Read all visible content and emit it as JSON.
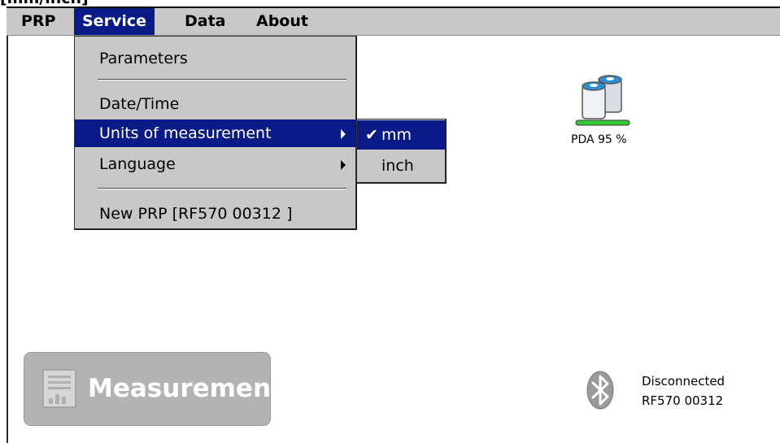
{
  "window": {
    "title_fragment": "[mm/inch]"
  },
  "menubar": {
    "items": [
      {
        "label": "PRP"
      },
      {
        "label": "Service"
      },
      {
        "label": "Data"
      },
      {
        "label": "About"
      }
    ],
    "active_index": 1
  },
  "service_menu": {
    "items": [
      {
        "label": "Parameters",
        "has_submenu": false
      },
      {
        "label": "Date/Time",
        "has_submenu": false
      },
      {
        "label": "Units of measurement",
        "has_submenu": true,
        "highlighted": true
      },
      {
        "label": "Language",
        "has_submenu": true
      },
      {
        "label": "New PRP [RF570 00312 ]",
        "has_submenu": false
      }
    ]
  },
  "units_submenu": {
    "items": [
      {
        "label": "mm",
        "checked": true,
        "highlighted": true,
        "check_glyph": "✔"
      },
      {
        "label": "inch",
        "checked": false
      }
    ]
  },
  "status": {
    "battery_label": "PDA 95 %",
    "battery_level": 0.95,
    "battery_icon": "battery-icon",
    "bluetooth_icon": "bluetooth-icon",
    "connection_status": "Disconnected",
    "device_name": "RF570 00312"
  },
  "actions": {
    "measurement_label": "Measurement",
    "measurement_icon": "document-chart-icon"
  },
  "colors": {
    "menu_bg": "#c8c8c8",
    "highlight": "#0a1a86",
    "button_bg": "#b3b3b3"
  }
}
